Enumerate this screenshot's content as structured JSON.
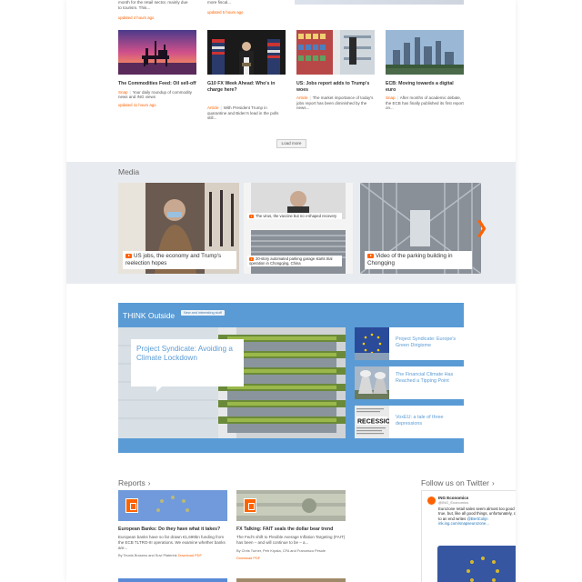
{
  "top": {
    "left_snippet_lines": [
      "month for the retail sector, mainly due",
      "to tourism. This..."
    ],
    "left_updated": "updated 4 hours ago",
    "mid_snippet": "more fiscal...",
    "mid_updated": "updated 5 hours ago"
  },
  "news": [
    {
      "title": "The Commodities Feed: Oil sell-off",
      "tag": "Snap",
      "desc": "Your daily roundup of commodity news and ING views",
      "updated": "updated 11 hours ago"
    },
    {
      "title": "G10 FX Week Ahead: Who's in charge here?",
      "tag": "Article",
      "desc": "With President Trump in quarantine and Biden's lead in the polls still..."
    },
    {
      "title": "US: Jobs report adds to Trump's woes",
      "tag": "Article",
      "desc": "The market importance of today's jobs report has been diminished by the news..."
    },
    {
      "title": "ECB: Moving towards a digital euro",
      "tag": "Snap",
      "desc": "After months of academic debate, the ECB has finally published its first report on..."
    }
  ],
  "load_more": "Load more",
  "media": {
    "heading": "Media",
    "tiles": [
      {
        "caption": "US jobs, the economy and Trump's reelection hopes"
      },
      {
        "caption_top": "The virus, the vaccine but no v-shaped recovery",
        "caption_bottom": "20-story automated parking garage starts trial operation in Chongqing, China"
      },
      {
        "caption": "Video of the parking building in Chongqing"
      }
    ],
    "next_icon": "chevron-right-icon"
  },
  "think": {
    "title": "THINK Outside",
    "badge": "New and interesting stuff",
    "feature_title": "Project Syndicate: Avoiding a Climate Lockdown",
    "items": [
      {
        "title": "Project Syndicate: Europe's Green Dirigisme"
      },
      {
        "title": "The Financial Climate Has Reached a Tipping Point"
      },
      {
        "title": "VoxEU: a tale of three depressions"
      }
    ]
  },
  "reports": {
    "heading": "Reports",
    "items": [
      {
        "title": "European Banks: Do they have what it takes?",
        "desc": "European banks have so far drawn €1,699bn funding from the ECB TLTRO-III operations. We examine whether banks are...",
        "byline": "By Teunis Brosens and Suvi Platerink",
        "download": "Download PDF"
      },
      {
        "title": "FX Talking: FAIT seals the dollar bear trend",
        "desc": "The Fed's shift to Flexible Average Inflation Targeting (FAIT) has been – and will continue to be – a...",
        "byline": "By Chris Turner, Petr Krpata, CFA and Francesco Pesole",
        "download": "Download PDF"
      }
    ]
  },
  "twitter": {
    "heading": "Follow us on Twitter",
    "name": "ING Economics",
    "handle": "@ING_Economics",
    "text": "Eurozone retail sales seem almost too good to be true, but, like all good things, unfortunately, come to an end writes",
    "link": "@BertColijn ink.ing.com/snapseurozone..."
  },
  "colors": {
    "accent": "#ff6200",
    "think_blue": "#5a9bd5",
    "media_bg": "#e8ebef"
  }
}
